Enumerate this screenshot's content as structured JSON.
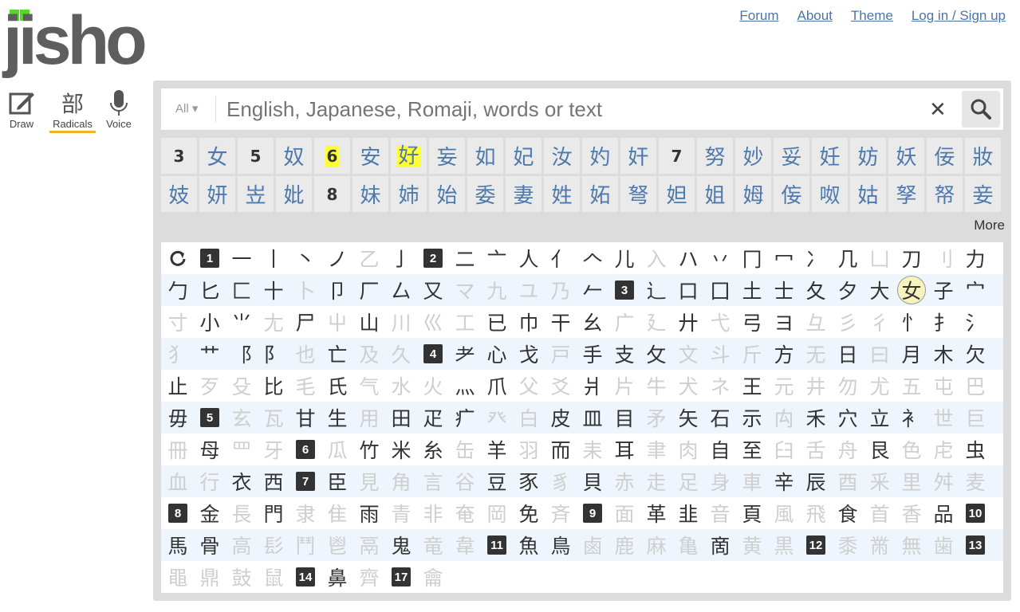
{
  "logo_text": "jisho",
  "nav": [
    "Forum",
    "About",
    "Theme",
    "Log in / Sign up"
  ],
  "modes": [
    {
      "label": "Draw",
      "icon": "pencil-icon"
    },
    {
      "label": "Radicals",
      "glyph": "部"
    },
    {
      "label": "Voice",
      "icon": "microphone-icon"
    }
  ],
  "search": {
    "filter": "All ▾",
    "placeholder": "English, Japanese, Romaji, words or text",
    "clear": "✕"
  },
  "more_label": "More",
  "results": [
    [
      [
        "count",
        "3"
      ],
      [
        "k",
        "女"
      ],
      [
        "count",
        "5"
      ],
      [
        "k",
        "奴"
      ],
      [
        "count-hl",
        "6"
      ],
      [
        "k",
        "安"
      ],
      [
        "k-hl",
        "好"
      ],
      [
        "k",
        "妄"
      ],
      [
        "k",
        "如"
      ],
      [
        "k",
        "妃"
      ],
      [
        "k",
        "汝"
      ],
      [
        "k",
        "妁"
      ],
      [
        "k",
        "奸"
      ],
      [
        "count",
        "7"
      ],
      [
        "k",
        "努"
      ],
      [
        "k",
        "妙"
      ],
      [
        "k",
        "妥"
      ],
      [
        "k",
        "妊"
      ],
      [
        "k",
        "妨"
      ],
      [
        "k",
        "妖"
      ],
      [
        "k",
        "佞"
      ],
      [
        "k",
        "妝"
      ]
    ],
    [
      [
        "k",
        "妓"
      ],
      [
        "k",
        "妍"
      ],
      [
        "k",
        "岦"
      ],
      [
        "k",
        "妣"
      ],
      [
        "count",
        "8"
      ],
      [
        "k",
        "妹"
      ],
      [
        "k",
        "姉"
      ],
      [
        "k",
        "始"
      ],
      [
        "k",
        "委"
      ],
      [
        "k",
        "妻"
      ],
      [
        "k",
        "姓"
      ],
      [
        "k",
        "妬"
      ],
      [
        "k",
        "弩"
      ],
      [
        "k",
        "妲"
      ],
      [
        "k",
        "姐"
      ],
      [
        "k",
        "姆"
      ],
      [
        "k",
        "侫"
      ],
      [
        "k",
        "呶"
      ],
      [
        "k",
        "姑"
      ],
      [
        "k",
        "孥"
      ],
      [
        "k",
        "帑"
      ],
      [
        "k",
        "妾"
      ]
    ]
  ],
  "radical_rows": [
    [
      "@reset",
      "#1",
      "一",
      "丨",
      "丶",
      "ノ",
      "~乙",
      "亅",
      "#2",
      "二",
      "亠",
      "人",
      "亻",
      "𠆢",
      "儿",
      "~入",
      "ハ",
      "丷",
      "冂",
      "冖",
      "冫",
      "几",
      "~凵",
      "刀",
      "~刂",
      "力"
    ],
    [
      "勹",
      "匕",
      "匚",
      "十",
      "~卜",
      "卩",
      "厂",
      "厶",
      "又",
      "~マ",
      "~九",
      "~ユ",
      "~乃",
      "𠂉",
      "#3",
      "辶",
      "口",
      "囗",
      "土",
      "士",
      "夂",
      "夕",
      "大",
      "@女",
      "子",
      "宀"
    ],
    [
      "~寸",
      "小",
      "⺌",
      "~尢",
      "尸",
      "~屮",
      "山",
      "~川",
      "~巛",
      "~工",
      "已",
      "巾",
      "干",
      "幺",
      "~广",
      "~廴",
      "廾",
      "~弋",
      "弓",
      "ヨ",
      "~彑",
      "~彡",
      "~彳",
      "忄",
      "扌",
      "氵"
    ],
    [
      "~犭",
      "艹",
      "⻏",
      "⻖",
      "~也",
      "亡",
      "~及",
      "~久",
      "#4",
      "⺹",
      "心",
      "戈",
      "~戸",
      "手",
      "支",
      "攵",
      "~文",
      "~斗",
      "~斤",
      "方",
      "~无",
      "日",
      "~曰",
      "月",
      "木",
      "欠"
    ],
    [
      "止",
      "~歹",
      "~殳",
      "比",
      "~毛",
      "氏",
      "~气",
      "~水",
      "~火",
      "灬",
      "爪",
      "~父",
      "~爻",
      "爿",
      "~片",
      "~牛",
      "~犬",
      "~ネ",
      "王",
      "~元",
      "~井",
      "~勿",
      "~尤",
      "~五",
      "~屯",
      "~巴"
    ],
    [
      "毋",
      "#5",
      "~玄",
      "~瓦",
      "甘",
      "生",
      "~用",
      "田",
      "疋",
      "疒",
      "~癶",
      "~白",
      "皮",
      "皿",
      "目",
      "~矛",
      "矢",
      "石",
      "示",
      "~禸",
      "禾",
      "穴",
      "立",
      "衤",
      "~世",
      "~巨"
    ],
    [
      "~冊",
      "母",
      "~罒",
      "~牙",
      "#6",
      "~瓜",
      "竹",
      "米",
      "糸",
      "~缶",
      "羊",
      "~羽",
      "而",
      "~耒",
      "耳",
      "~聿",
      "~肉",
      "自",
      "至",
      "~臼",
      "~舌",
      "~舟",
      "艮",
      "~色",
      "~虍",
      "虫"
    ],
    [
      "~血",
      "~行",
      "衣",
      "西",
      "#7",
      "臣",
      "~見",
      "~角",
      "~言",
      "~谷",
      "豆",
      "豕",
      "~豸",
      "貝",
      "~赤",
      "~走",
      "~足",
      "~身",
      "~車",
      "辛",
      "辰",
      "~酉",
      "~釆",
      "~里",
      "~舛",
      "~麦"
    ],
    [
      "#8",
      "金",
      "~長",
      "門",
      "~隶",
      "~隹",
      "雨",
      "~青",
      "~非",
      "~奄",
      "~岡",
      "免",
      "~斉",
      "#9",
      "~面",
      "革",
      "韭",
      "~音",
      "頁",
      "~風",
      "~飛",
      "食",
      "~首",
      "~香",
      "品",
      "#10"
    ],
    [
      "馬",
      "骨",
      "~高",
      "~髟",
      "~鬥",
      "~鬯",
      "~鬲",
      "鬼",
      "~竜",
      "~韋",
      "#11",
      "魚",
      "鳥",
      "~鹵",
      "~鹿",
      "~麻",
      "~亀",
      "啇",
      "~黄",
      "~黒",
      "#12",
      "~黍",
      "~黹",
      "~無",
      "~歯",
      "#13"
    ],
    [
      "~黽",
      "~鼎",
      "~鼓",
      "~鼠",
      "#14",
      "鼻",
      "~齊",
      "#17",
      "~龠"
    ]
  ]
}
